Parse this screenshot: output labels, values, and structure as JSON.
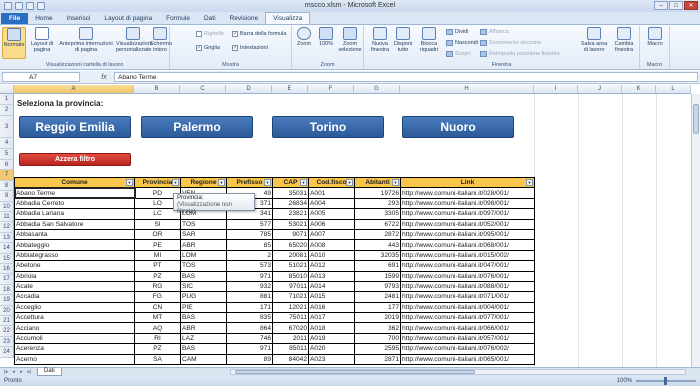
{
  "app": {
    "title": "mscco.xlsm - Microsoft Excel",
    "window_controls": [
      "–",
      "□",
      "✕"
    ]
  },
  "ribbon_tabs": [
    {
      "label": "File"
    },
    {
      "label": "Home"
    },
    {
      "label": "Inserisci"
    },
    {
      "label": "Layout di pagina"
    },
    {
      "label": "Formule"
    },
    {
      "label": "Dati"
    },
    {
      "label": "Revisione"
    },
    {
      "label": "Visualizza"
    }
  ],
  "ribbon": {
    "groups": {
      "views": "Visualizzazioni cartella di lavoro",
      "show": "Mostra",
      "zoom": "Zoom",
      "window": "Finestra",
      "macro": "Macro"
    },
    "views": {
      "normal": "Normale",
      "page_layout": "Layout di pagina",
      "page_break": "Anteprima interruzioni di pagina",
      "custom": "Visualizzazioni personalizzate",
      "fullscreen": "Schermo intero"
    },
    "show": {
      "ruler": "Righello",
      "formula_bar": "Barra della formula",
      "gridlines": "Griglia",
      "headings": "Intestazioni"
    },
    "zoom": {
      "zoom": "Zoom",
      "zoom100": "100%",
      "zoom_sel": "Zoom selezione"
    },
    "window": {
      "new_window": "Nuova finestra",
      "arrange": "Disponi tutto",
      "freeze": "Blocca riquadri",
      "split": "Dividi",
      "hide": "Nascondi",
      "unhide": "Scopri",
      "side_by_side": "Affianca",
      "sync_scroll": "Scorrimento sincrono",
      "reset_pos": "Reimposta posizione finestra",
      "save_ws": "Salva area di lavoro",
      "switch": "Cambia finestra"
    },
    "macro": {
      "macro": "Macro"
    }
  },
  "formula_bar": {
    "name_box": "A7",
    "fx": "fx",
    "content": "Abano Terme"
  },
  "columns": [
    "A",
    "B",
    "C",
    "D",
    "E",
    "F",
    "G",
    "H",
    "I",
    "J",
    "K",
    "L"
  ],
  "rows": [
    "1",
    "2",
    "3",
    "4",
    "5",
    "6",
    "7",
    "8",
    "9",
    "10",
    "11",
    "12",
    "13",
    "14",
    "15",
    "16",
    "17",
    "18",
    "19",
    "20",
    "21",
    "22",
    "23",
    "24"
  ],
  "sheet": {
    "title": "Seleziona la provincia:",
    "buttons": [
      "Reggio Emilia",
      "Palermo",
      "Torino",
      "Nuoro"
    ],
    "reset": "Azzera filtro"
  },
  "table": {
    "headers": [
      "Comune",
      "Provincia",
      "Regione",
      "Prefisso",
      "CAP",
      "Cod.fisco",
      "Abitanti",
      "Link"
    ],
    "rows": [
      [
        "Abano Terme",
        "PD",
        "VEN",
        "49",
        "35031",
        "A001",
        "19726",
        "http://www.comuni-italiani.it/028/001/"
      ],
      [
        "Abbadia Cerreto",
        "LO",
        "LOM",
        "371",
        "26834",
        "A004",
        "293",
        "http://www.comuni-italiani.it/098/001/"
      ],
      [
        "Abbadia Lariana",
        "LC",
        "LOM",
        "341",
        "23821",
        "A005",
        "3305",
        "http://www.comuni-italiani.it/097/001/"
      ],
      [
        "Abbadia San Salvatore",
        "SI",
        "TOS",
        "577",
        "53021",
        "A006",
        "6722",
        "http://www.comuni-italiani.it/052/001/"
      ],
      [
        "Abbasanta",
        "OR",
        "SAR",
        "785",
        "9071",
        "A007",
        "2872",
        "http://www.comuni-italiani.it/095/001/"
      ],
      [
        "Abbateggio",
        "PE",
        "ABR",
        "85",
        "65020",
        "A008",
        "443",
        "http://www.comuni-italiani.it/068/001/"
      ],
      [
        "Abbiategrasso",
        "MI",
        "LOM",
        "2",
        "20081",
        "A010",
        "32035",
        "http://www.comuni-italiani.it/015/002/"
      ],
      [
        "Abetone",
        "PT",
        "TOS",
        "573",
        "51021",
        "A012",
        "691",
        "http://www.comuni-italiani.it/047/001/"
      ],
      [
        "Abriola",
        "PZ",
        "BAS",
        "971",
        "85010",
        "A013",
        "1599",
        "http://www.comuni-italiani.it/076/001/"
      ],
      [
        "Acate",
        "RG",
        "SIC",
        "932",
        "97011",
        "A014",
        "9793",
        "http://www.comuni-italiani.it/088/001/"
      ],
      [
        "Accadia",
        "FG",
        "PUG",
        "881",
        "71021",
        "A015",
        "2481",
        "http://www.comuni-italiani.it/071/001/"
      ],
      [
        "Acceglio",
        "CN",
        "PIE",
        "171",
        "12021",
        "A016",
        "177",
        "http://www.comuni-italiani.it/004/001/"
      ],
      [
        "Accettura",
        "MT",
        "BAS",
        "835",
        "75011",
        "A017",
        "2019",
        "http://www.comuni-italiani.it/077/001/"
      ],
      [
        "Acciano",
        "AQ",
        "ABR",
        "864",
        "67020",
        "A018",
        "362",
        "http://www.comuni-italiani.it/066/001/"
      ],
      [
        "Accumoli",
        "RI",
        "LAZ",
        "746",
        "2011",
        "A019",
        "700",
        "http://www.comuni-italiani.it/057/001/"
      ],
      [
        "Acerenza",
        "PZ",
        "BAS",
        "971",
        "85011",
        "A020",
        "2595",
        "http://www.comuni-italiani.it/076/002/"
      ],
      [
        "Acerno",
        "SA",
        "CAM",
        "89",
        "84042",
        "A023",
        "2871",
        "http://www.comuni-italiani.it/065/001/"
      ]
    ]
  },
  "tooltip": {
    "title": "Provincia:",
    "subtitle": "(Visualizzazione non filtrata)"
  },
  "sheet_tabs": [
    {
      "label": "Dati"
    }
  ],
  "status": {
    "left": "Pronto",
    "zoom": "100%"
  }
}
